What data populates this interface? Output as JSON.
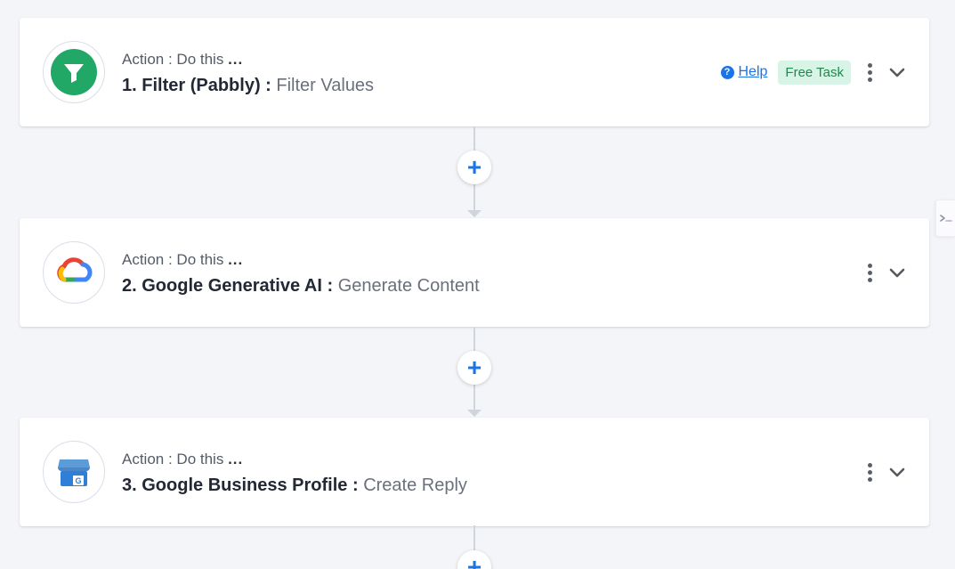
{
  "steps": [
    {
      "kind": "Action : Do this",
      "ellipsis": "...",
      "number": "1.",
      "app": "Filter (Pabbly) :",
      "event": "Filter Values",
      "logo_icon": "filter-funnel-icon",
      "help_label": "Help",
      "badge": "Free Task"
    },
    {
      "kind": "Action : Do this",
      "ellipsis": "...",
      "number": "2.",
      "app": "Google Generative AI :",
      "event": "Generate Content",
      "logo_icon": "google-cloud-icon"
    },
    {
      "kind": "Action : Do this",
      "ellipsis": "...",
      "number": "3.",
      "app": "Google Business Profile :",
      "event": "Create Reply",
      "logo_icon": "google-business-profile-icon"
    }
  ],
  "add_step_label": "+",
  "help_glyph": "?",
  "icons": {
    "menu": "kebab-menu-icon",
    "expand": "chevron-down-icon"
  },
  "colors": {
    "accent": "#1b73e8",
    "filter_green": "#22a866",
    "badge_bg": "#d7f4e6",
    "badge_text": "#1e8a4c",
    "page_bg": "#f3f5f8"
  }
}
